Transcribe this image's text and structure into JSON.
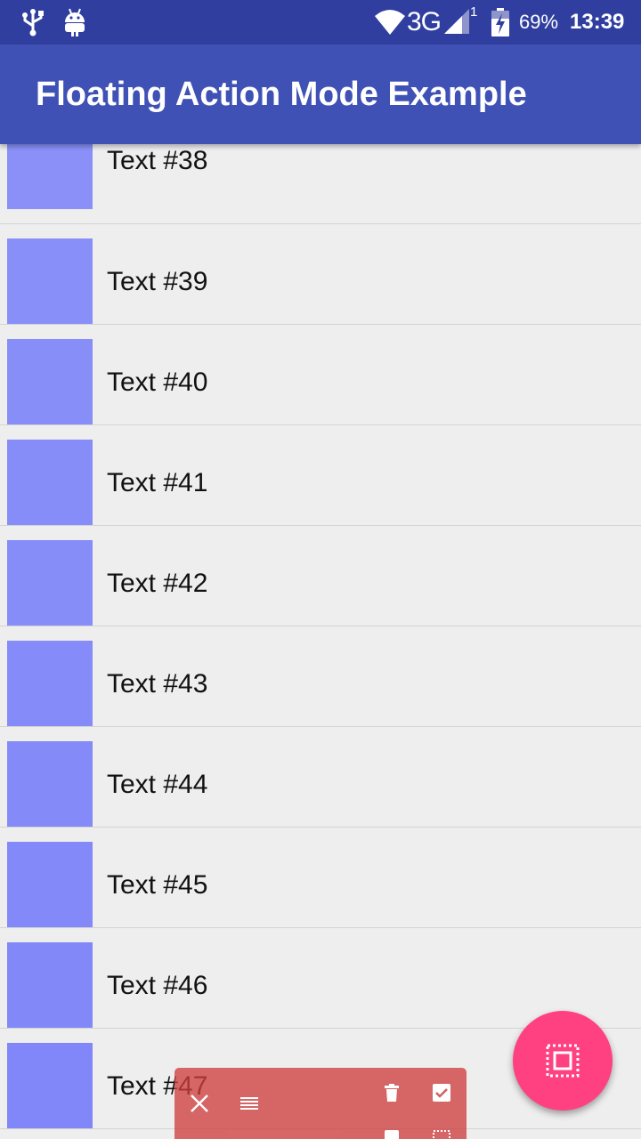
{
  "status_bar": {
    "left_icons": [
      "usb-icon",
      "android-debug-icon"
    ],
    "network_type": "3G",
    "sim_slot": "1",
    "battery_percent": "69%",
    "battery_level": 0.69,
    "time": "13:39",
    "colors": {
      "background": "#303f9f",
      "foreground": "#ffffff"
    }
  },
  "app_bar": {
    "title": "Floating Action Mode Example",
    "colors": {
      "background": "#3f51b5",
      "title": "#ffffff"
    }
  },
  "list": {
    "items": [
      {
        "label": "Text #38",
        "color": "#8a90f8"
      },
      {
        "label": "Text #39",
        "color": "#898ff8"
      },
      {
        "label": "Text #40",
        "color": "#888ef8"
      },
      {
        "label": "Text #41",
        "color": "#878df8"
      },
      {
        "label": "Text #42",
        "color": "#868cf8"
      },
      {
        "label": "Text #43",
        "color": "#858bf8"
      },
      {
        "label": "Text #44",
        "color": "#848af8"
      },
      {
        "label": "Text #45",
        "color": "#8389f8"
      },
      {
        "label": "Text #46",
        "color": "#8288f8"
      },
      {
        "label": "Text #47",
        "color": "#8187f8"
      }
    ],
    "colors": {
      "background": "#eeeeee",
      "divider": "#d4d4d4",
      "text": "#111111"
    }
  },
  "floating_action_mode": {
    "buttons": [
      "close-icon",
      "reorder-icon",
      "delete-icon",
      "check-box-icon",
      "select-all-icon"
    ],
    "colors": {
      "background": "#d04040"
    }
  },
  "fab": {
    "icon": "select-all-icon",
    "colors": {
      "background": "#ff4081",
      "icon": "#ffffff"
    }
  }
}
